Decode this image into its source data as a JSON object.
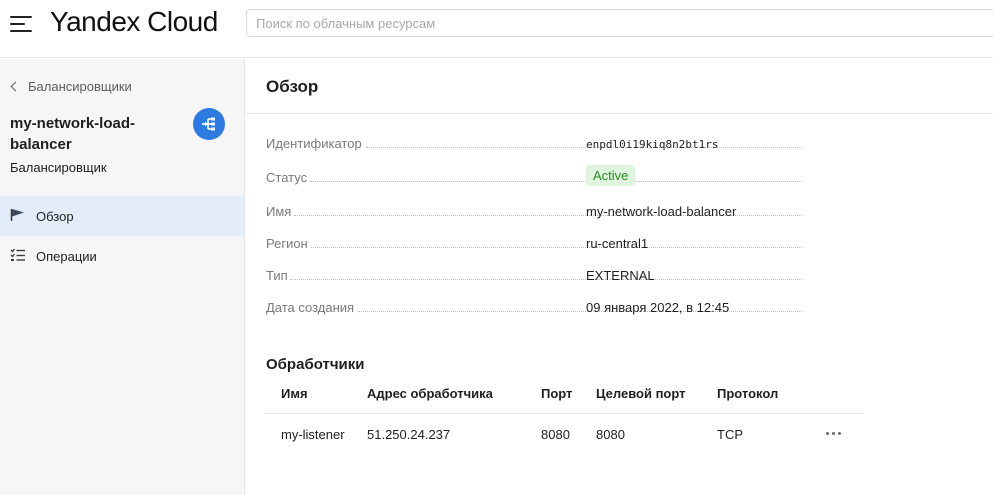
{
  "header": {
    "logo_main": "Yandex",
    "logo_sub": "Cloud",
    "search_placeholder": "Поиск по облачным ресурсам"
  },
  "sidebar": {
    "back_label": "Балансировщики",
    "resource_name": "my-network-load-balancer",
    "resource_type": "Балансировщик",
    "icon_color": "#2d7be0",
    "items": [
      {
        "label": "Обзор",
        "icon": "flag-icon",
        "active": true
      },
      {
        "label": "Операции",
        "icon": "checklist-icon",
        "active": false
      }
    ]
  },
  "main": {
    "title": "Обзор",
    "properties": [
      {
        "label": "Идентификатор",
        "value": "enpdl0i19kiq8n2bt1rs"
      },
      {
        "label": "Статус",
        "value": "Active"
      },
      {
        "label": "Имя",
        "value": "my-network-load-balancer"
      },
      {
        "label": "Регион",
        "value": "ru-central1"
      },
      {
        "label": "Тип",
        "value": "EXTERNAL"
      },
      {
        "label": "Дата создания",
        "value": "09 января 2022, в 12:45"
      }
    ],
    "status_color": "#2b8a22",
    "listeners_title": "Обработчики",
    "listeners_columns": [
      "Имя",
      "Адрес обработчика",
      "Порт",
      "Целевой порт",
      "Протокол"
    ],
    "listeners": [
      {
        "name": "my-listener",
        "address": "51.250.24.237",
        "port": "8080",
        "target_port": "8080",
        "protocol": "TCP"
      }
    ]
  }
}
